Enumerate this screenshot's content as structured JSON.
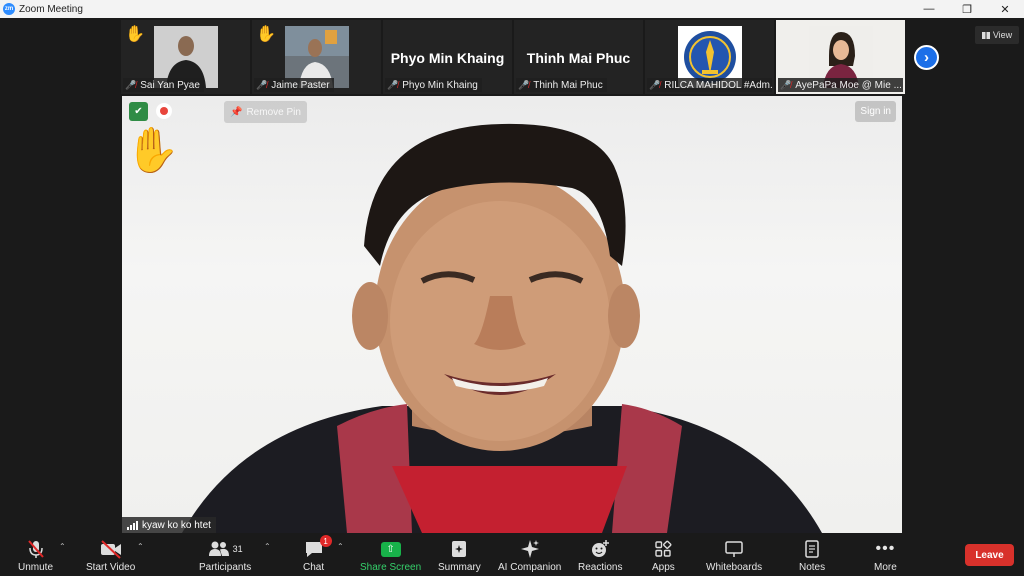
{
  "window": {
    "title": "Zoom Meeting",
    "logo": "zm"
  },
  "gallery": {
    "tiles": [
      {
        "name": "Sai Yan Pyae",
        "hand": true,
        "type": "photo"
      },
      {
        "name": "Jaime Paster",
        "hand": true,
        "type": "photo"
      },
      {
        "name": "Phyo Min Khaing",
        "display": "Phyo Min Khaing",
        "type": "text"
      },
      {
        "name": "Thinh Mai Phuc",
        "display": "Thinh Mai Phuc",
        "type": "text"
      },
      {
        "name": "RILCA MAHIDOL #Adm...",
        "type": "logo"
      },
      {
        "name": "AyePaPa Moe @ Mie ...",
        "type": "photo-light"
      }
    ],
    "view_label": "View"
  },
  "main_video": {
    "remove_pin": "Remove Pin",
    "sign_in": "Sign in",
    "speaker": "kyaw ko ko htet"
  },
  "toolbar": {
    "unmute": "Unmute",
    "start_video": "Start Video",
    "participants": "Participants",
    "participants_count": "31",
    "chat": "Chat",
    "chat_badge": "1",
    "share_screen": "Share Screen",
    "summary": "Summary",
    "ai_companion": "AI Companion",
    "reactions": "Reactions",
    "apps": "Apps",
    "whiteboards": "Whiteboards",
    "notes": "Notes",
    "more": "More",
    "leave": "Leave"
  },
  "colors": {
    "accent": "#1c6fe8",
    "share": "#18b24a",
    "leave": "#d8312b",
    "muted": "#e02828"
  }
}
